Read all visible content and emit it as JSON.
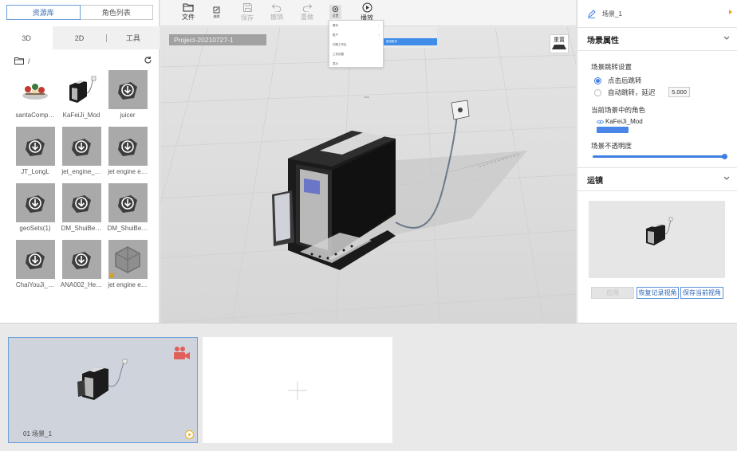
{
  "left_panel": {
    "top_tabs": [
      {
        "label": "资源库",
        "active": true
      },
      {
        "label": "角色列表",
        "active": false
      }
    ],
    "sub_tabs": [
      {
        "label": "3D",
        "active": true
      },
      {
        "label": "2D",
        "active": false
      },
      {
        "label": "工具",
        "active": false
      }
    ],
    "path": "/",
    "assets": [
      {
        "label": "santaComp…",
        "thumb": "santa"
      },
      {
        "label": "KaFeiJi_Mod",
        "thumb": "coffee"
      },
      {
        "label": "juicer",
        "thumb": "download"
      },
      {
        "label": "JT_LongL",
        "thumb": "download"
      },
      {
        "label": "jet_engine_…",
        "thumb": "download"
      },
      {
        "label": "jet engine e…",
        "thumb": "download"
      },
      {
        "label": "geoSets(1)",
        "thumb": "download"
      },
      {
        "label": "DM_ShuiBe…",
        "thumb": "download"
      },
      {
        "label": "DM_ShuiBe…",
        "thumb": "download"
      },
      {
        "label": "ChaiYouJi_…",
        "thumb": "download"
      },
      {
        "label": "ANA002_He…",
        "thumb": "download"
      },
      {
        "label": "jet engine e…",
        "thumb": "box"
      }
    ]
  },
  "toolbar": {
    "file": "文件",
    "edit": "编辑",
    "save": "保存",
    "undo": "撤销",
    "redo": "重做",
    "settings": "设置",
    "play": "播放"
  },
  "viewport": {
    "project_label": "Project-20210727-1",
    "reset_label": "重置",
    "menu_items": [
      "基本",
      "账户",
      "切换工作区",
      "上传设置",
      "显示"
    ],
    "submenu_item": "重设账号"
  },
  "right_panel": {
    "scene_name": "场景_1",
    "scene_props_title": "场景属性",
    "jump_settings": "场景跳转设置",
    "option_click": "点击后跳转",
    "option_auto": "自动跳转，延迟",
    "delay_value": "5.000",
    "roles_title": "当前场景中的角色",
    "role_name": "KaFeiJi_Mod",
    "opacity_title": "场景不透明度",
    "opacity_value": 1.0,
    "camera_title": "运镜",
    "btn_apply": "应用",
    "btn_restore": "恢复记录视角",
    "btn_save_view": "保存当前视角"
  },
  "bottom": {
    "scene_card_label": "01  场景_1"
  },
  "colors": {
    "accent": "#3f7fe0",
    "camera_icon": "#e0605a",
    "play_icon": "#f0b020"
  }
}
